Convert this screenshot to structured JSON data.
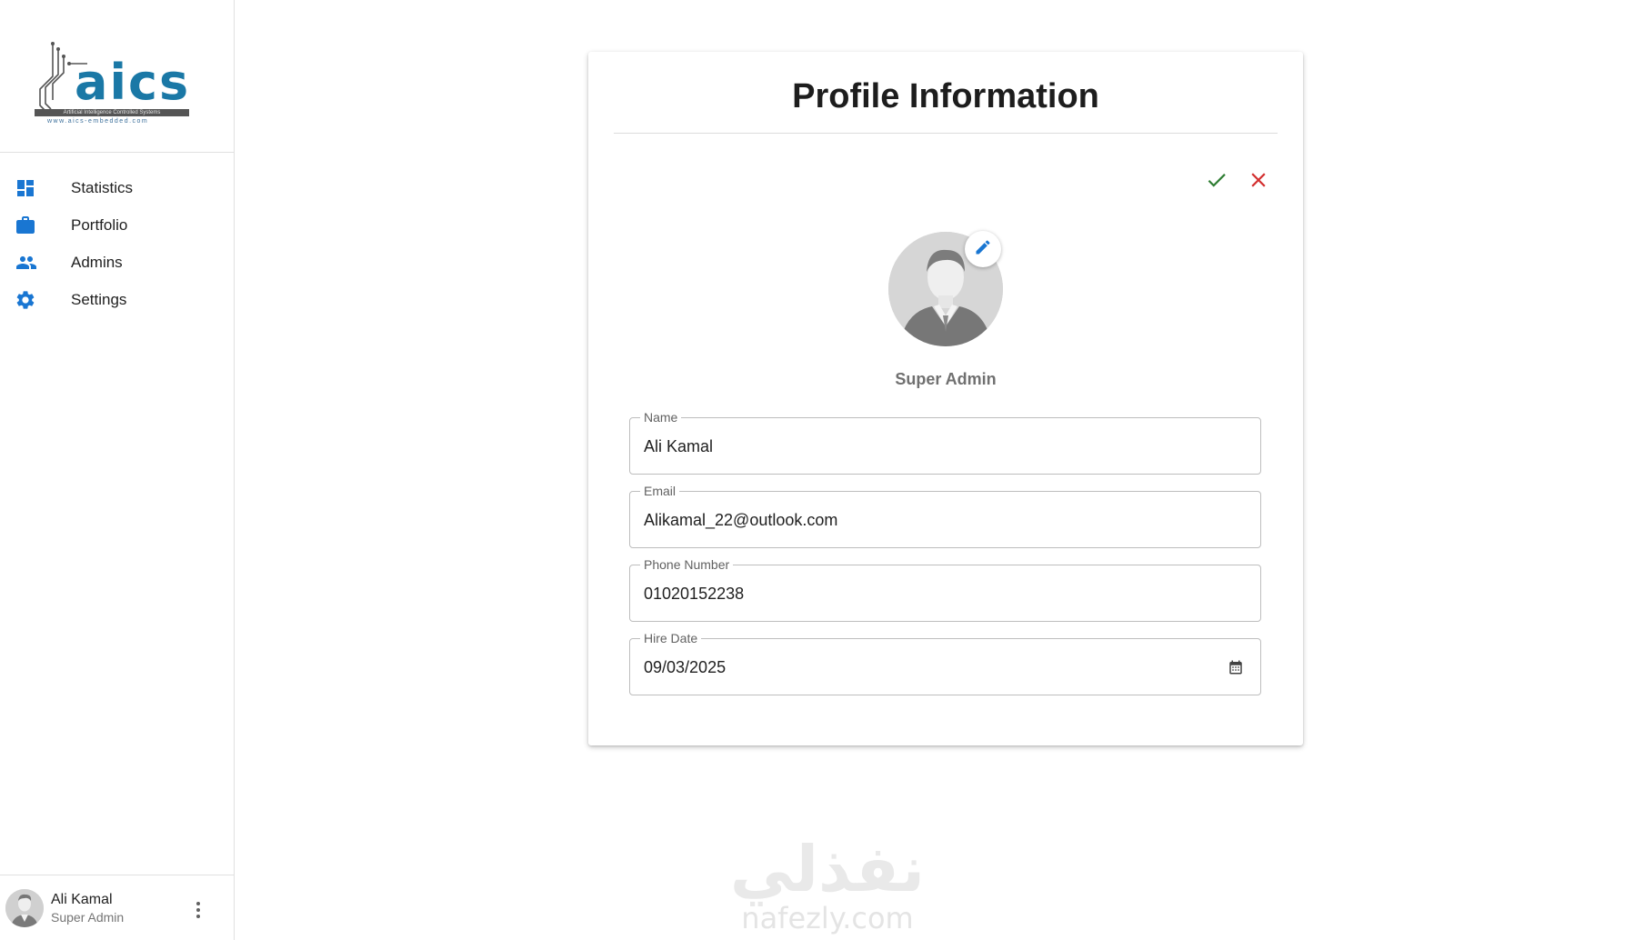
{
  "brand": {
    "logo_text": "aics",
    "logo_tagline": "Artificial Intelligence Controlled Systems",
    "logo_url": "www.aics-embedded.com"
  },
  "sidebar": {
    "items": [
      {
        "label": "Statistics",
        "icon": "dashboard-icon"
      },
      {
        "label": "Portfolio",
        "icon": "briefcase-icon"
      },
      {
        "label": "Admins",
        "icon": "people-icon"
      },
      {
        "label": "Settings",
        "icon": "gear-icon"
      }
    ],
    "icon_color": "#1976d2"
  },
  "user": {
    "name": "Ali Kamal",
    "role": "Super Admin"
  },
  "profile": {
    "title": "Profile Information",
    "role": "Super Admin",
    "fields": {
      "name": {
        "label": "Name",
        "value": "Ali Kamal"
      },
      "email": {
        "label": "Email",
        "value": "Alikamal_22@outlook.com"
      },
      "phone": {
        "label": "Phone Number",
        "value": "01020152238"
      },
      "hire_date": {
        "label": "Hire Date",
        "value": "09/03/2025"
      }
    },
    "confirm_color": "#2e7d32",
    "cancel_color": "#d32f2f"
  },
  "watermark": {
    "arabic": "نفذلي",
    "latin": "nafezly.com"
  }
}
